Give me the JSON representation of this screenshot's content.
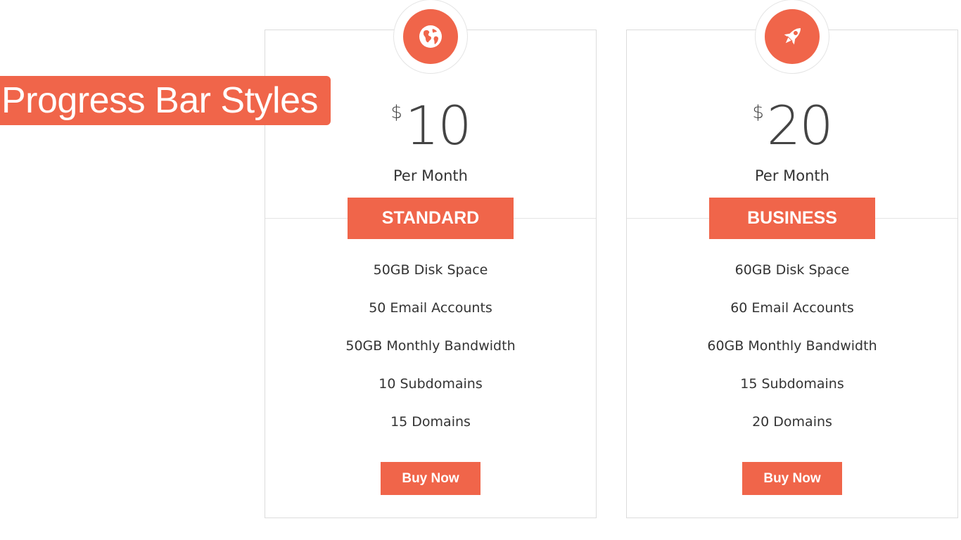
{
  "banner": {
    "title": "Progress Bar Styles"
  },
  "colors": {
    "accent": "#f0654a",
    "text": "#333333",
    "border": "#dcdcdc"
  },
  "plans": [
    {
      "icon": "globe-icon",
      "currency": "$",
      "amount": "10",
      "period": "Per Month",
      "name": "STANDARD",
      "features": [
        "50GB Disk Space",
        "50 Email Accounts",
        "50GB Monthly Bandwidth",
        "10 Subdomains",
        "15 Domains"
      ],
      "button": "Buy Now"
    },
    {
      "icon": "rocket-icon",
      "currency": "$",
      "amount": "20",
      "period": "Per Month",
      "name": "BUSINESS",
      "features": [
        "60GB Disk Space",
        "60 Email Accounts",
        "60GB Monthly Bandwidth",
        "15 Subdomains",
        "20 Domains"
      ],
      "button": "Buy Now"
    }
  ]
}
